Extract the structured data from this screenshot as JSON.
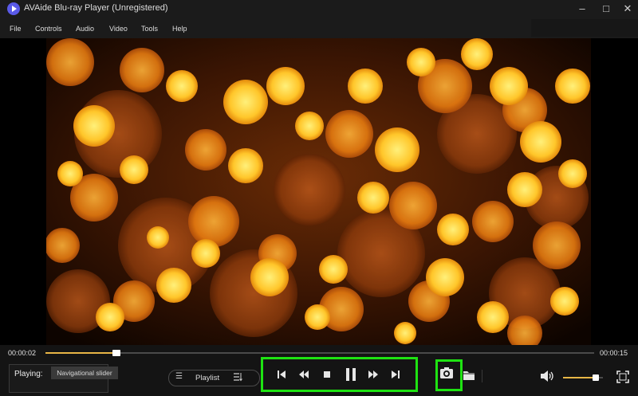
{
  "window": {
    "title": "AVAide Blu-ray Player (Unregistered)",
    "controls": [
      "minimize-icon",
      "maximize-icon",
      "close-icon"
    ]
  },
  "menu": {
    "items": [
      "File",
      "Controls",
      "Audio",
      "Video",
      "Tools",
      "Help"
    ]
  },
  "player": {
    "current_time": "00:00:02",
    "total_time": "00:00:15",
    "progress_fraction": 0.13,
    "playing_label": "Playing:",
    "tooltip": "Navigational slider",
    "playlist_label": "Playlist",
    "volume_fraction": 0.82,
    "accent_color": "#e8b646",
    "highlight_color": "#1ee312"
  },
  "transport_icons": [
    "skip-previous-icon",
    "rewind-icon",
    "stop-icon",
    "pause-icon",
    "fast-forward-icon",
    "skip-next-icon"
  ],
  "tool_icons": [
    "snapshot-icon",
    "folder-icon",
    "volume-icon",
    "fullscreen-icon"
  ]
}
